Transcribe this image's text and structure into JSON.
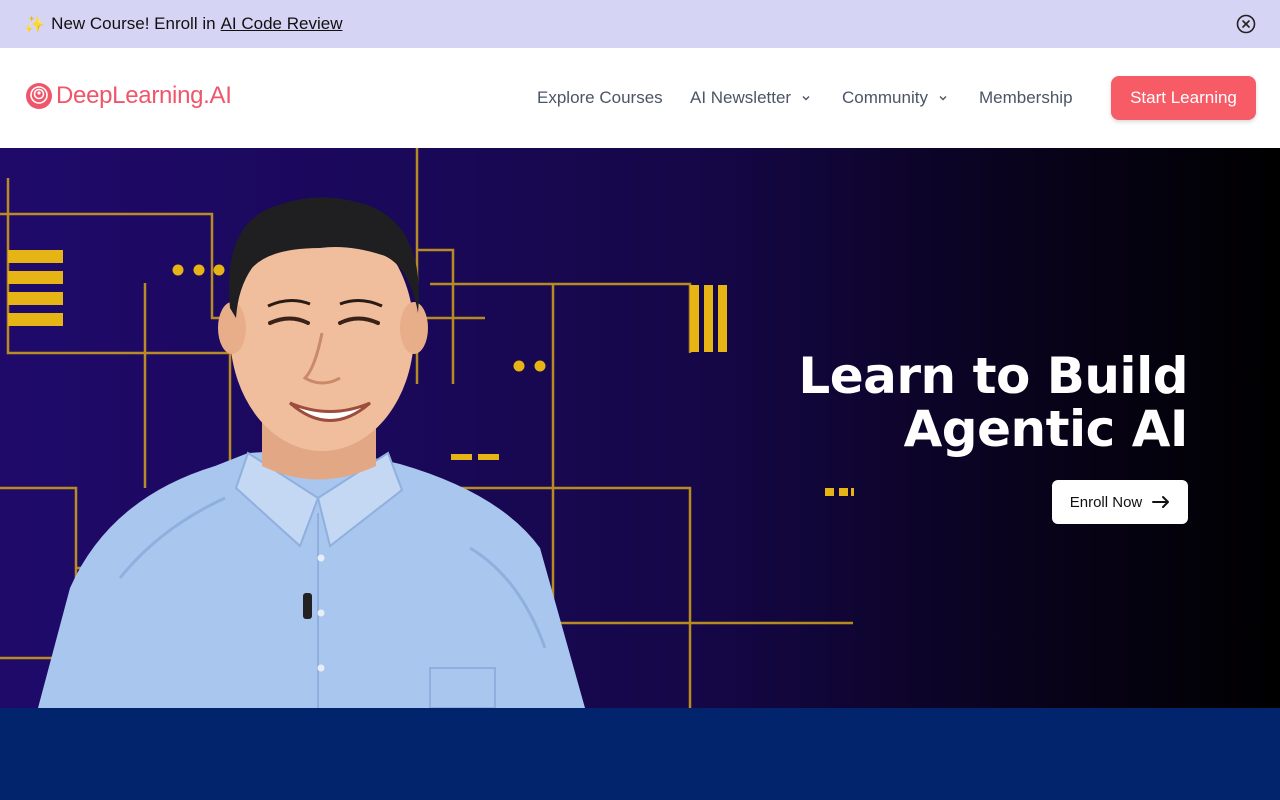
{
  "announcement": {
    "sparkle": "✨",
    "text": "New Course! Enroll in",
    "link_label": "AI Code Review",
    "close_icon": "close-circle-icon"
  },
  "nav": {
    "logo_text": "DeepLearning.AI",
    "items": [
      {
        "label": "Explore Courses",
        "has_dropdown": false
      },
      {
        "label": "AI Newsletter",
        "has_dropdown": true
      },
      {
        "label": "Community",
        "has_dropdown": true
      },
      {
        "label": "Membership",
        "has_dropdown": false
      }
    ],
    "cta_label": "Start Learning"
  },
  "hero": {
    "headline_line1": "Learn to Build",
    "headline_line2": "Agentic AI",
    "button_label": "Enroll Now",
    "button_icon": "arrow-right-icon"
  },
  "colors": {
    "brand": "#f65b66",
    "announcement_bg": "#d6d4f4",
    "hero_accent": "#e7b416",
    "band": "#01246d"
  }
}
